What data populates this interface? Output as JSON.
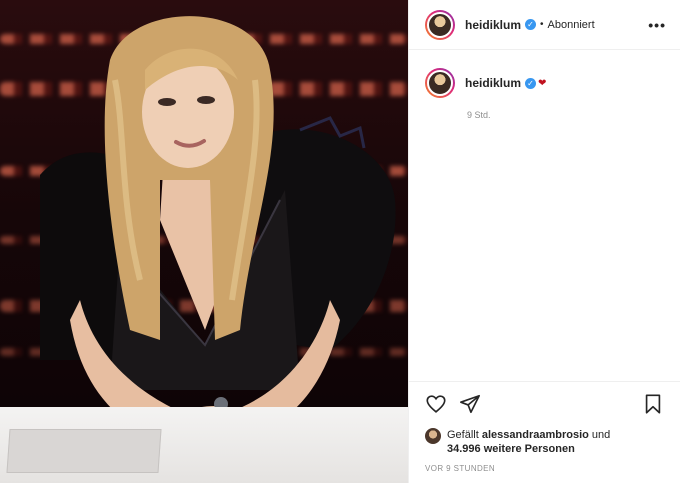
{
  "post": {
    "image_alt": "heidiklum",
    "header": {
      "username": "heidiklum",
      "separator": "•",
      "follow_status": "Abonniert",
      "more_icon": "more-options-icon",
      "more_label": "•••"
    },
    "caption": {
      "username": "heidiklum",
      "emoji": "❤",
      "time": "9 Std."
    },
    "actions": {
      "like_icon": "heart-icon",
      "share_icon": "paper-plane-icon",
      "save_icon": "bookmark-icon"
    },
    "likes": {
      "prefix": "Gefällt",
      "liker": "alessandraambrosio",
      "connector": "und",
      "others": "34.996 weitere Personen"
    },
    "timestamp": "VOR 9 STUNDEN"
  },
  "colors": {
    "verified": "#3897f0",
    "text": "#262626",
    "muted": "#8e8e8e",
    "border": "#efefef"
  }
}
